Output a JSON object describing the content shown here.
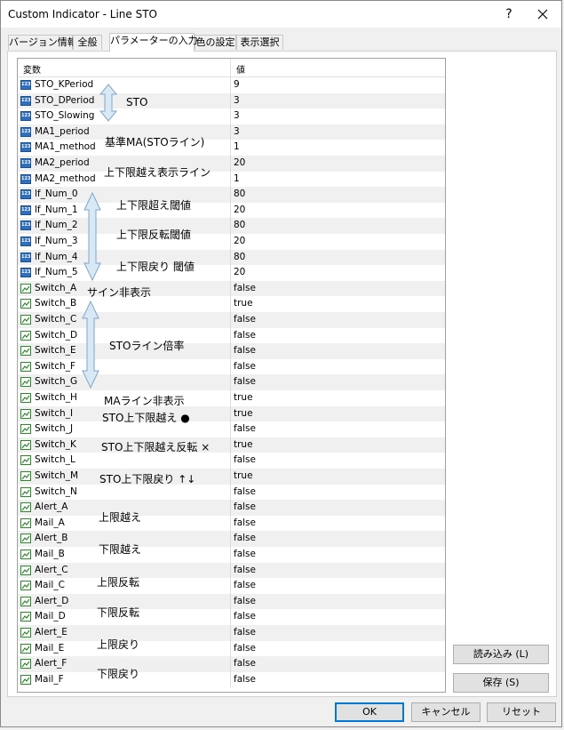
{
  "window": {
    "title": "Custom Indicator - Line STO",
    "help_label": "?",
    "close_icon": "close-icon"
  },
  "tabs": [
    {
      "label": "バージョン情報",
      "active": false
    },
    {
      "label": "全般",
      "active": false
    },
    {
      "label": "パラメーターの入力",
      "active": true
    },
    {
      "label": "色の設定",
      "active": false
    },
    {
      "label": "表示選択",
      "active": false
    }
  ],
  "grid": {
    "header": {
      "name": "変数",
      "value": "値"
    },
    "rows": [
      {
        "name": "STO_KPeriod",
        "value": "9",
        "type": "int"
      },
      {
        "name": "STO_DPeriod",
        "value": "3",
        "type": "int"
      },
      {
        "name": "STO_Slowing",
        "value": "3",
        "type": "int"
      },
      {
        "name": "MA1_period",
        "value": "3",
        "type": "int"
      },
      {
        "name": "MA1_method",
        "value": "1",
        "type": "int"
      },
      {
        "name": "MA2_period",
        "value": "20",
        "type": "int"
      },
      {
        "name": "MA2_method",
        "value": "1",
        "type": "int"
      },
      {
        "name": "lf_Num_0",
        "value": "80",
        "type": "int"
      },
      {
        "name": "lf_Num_1",
        "value": "20",
        "type": "int"
      },
      {
        "name": "lf_Num_2",
        "value": "80",
        "type": "int"
      },
      {
        "name": "lf_Num_3",
        "value": "20",
        "type": "int"
      },
      {
        "name": "lf_Num_4",
        "value": "80",
        "type": "int"
      },
      {
        "name": "lf_Num_5",
        "value": "20",
        "type": "int"
      },
      {
        "name": "Switch_A",
        "value": "false",
        "type": "bool"
      },
      {
        "name": "Switch_B",
        "value": "true",
        "type": "bool"
      },
      {
        "name": "Switch_C",
        "value": "false",
        "type": "bool"
      },
      {
        "name": "Switch_D",
        "value": "false",
        "type": "bool"
      },
      {
        "name": "Switch_E",
        "value": "false",
        "type": "bool"
      },
      {
        "name": "Switch_F",
        "value": "false",
        "type": "bool"
      },
      {
        "name": "Switch_G",
        "value": "false",
        "type": "bool"
      },
      {
        "name": "Switch_H",
        "value": "true",
        "type": "bool"
      },
      {
        "name": "Switch_I",
        "value": "true",
        "type": "bool"
      },
      {
        "name": "Switch_J",
        "value": "false",
        "type": "bool"
      },
      {
        "name": "Switch_K",
        "value": "true",
        "type": "bool"
      },
      {
        "name": "Switch_L",
        "value": "false",
        "type": "bool"
      },
      {
        "name": "Switch_M",
        "value": "true",
        "type": "bool"
      },
      {
        "name": "Switch_N",
        "value": "false",
        "type": "bool"
      },
      {
        "name": "Alert_A",
        "value": "false",
        "type": "bool"
      },
      {
        "name": "Mail_A",
        "value": "false",
        "type": "bool"
      },
      {
        "name": "Alert_B",
        "value": "false",
        "type": "bool"
      },
      {
        "name": "Mail_B",
        "value": "false",
        "type": "bool"
      },
      {
        "name": "Alert_C",
        "value": "false",
        "type": "bool"
      },
      {
        "name": "Mail_C",
        "value": "false",
        "type": "bool"
      },
      {
        "name": "Alert_D",
        "value": "false",
        "type": "bool"
      },
      {
        "name": "Mail_D",
        "value": "false",
        "type": "bool"
      },
      {
        "name": "Alert_E",
        "value": "false",
        "type": "bool"
      },
      {
        "name": "Mail_E",
        "value": "false",
        "type": "bool"
      },
      {
        "name": "Alert_F",
        "value": "false",
        "type": "bool"
      },
      {
        "name": "Mail_F",
        "value": "false",
        "type": "bool"
      }
    ]
  },
  "annotations": {
    "sto": "STO",
    "base_ma": "基準MA(STOライン)",
    "limit_line": "上下限越え表示ライン",
    "over_threshold": "上下限超え閾値",
    "reversal_threshold": "上下限反転閾値",
    "return_threshold": "上下限戻り 閾値",
    "sign_hide": "サイン非表示",
    "sto_line_scale": "STOライン倍率",
    "ma_line_hide": "MAライン非表示",
    "sto_over": "STO上下限越え ●",
    "sto_over_reverse": "STO上下限越え反転 ×",
    "sto_return": "STO上下限戻り ↑↓",
    "upper_over": "上限越え",
    "lower_over": "下限越え",
    "upper_reverse": "上限反転",
    "lower_reverse": "下限反転",
    "upper_return": "上限戻り",
    "lower_return": "下限戻り"
  },
  "buttons": {
    "load": "読み込み (L)",
    "save": "保存 (S)",
    "ok": "OK",
    "cancel": "キャンセル",
    "reset": "リセット"
  },
  "colors": {
    "int_icon": "#2f6fbf",
    "bool_icon": "#2a8a2a",
    "arrow_fill": "#d8e8f5",
    "arrow_stroke": "#7fa6c9",
    "ok_border": "#0078d7"
  }
}
